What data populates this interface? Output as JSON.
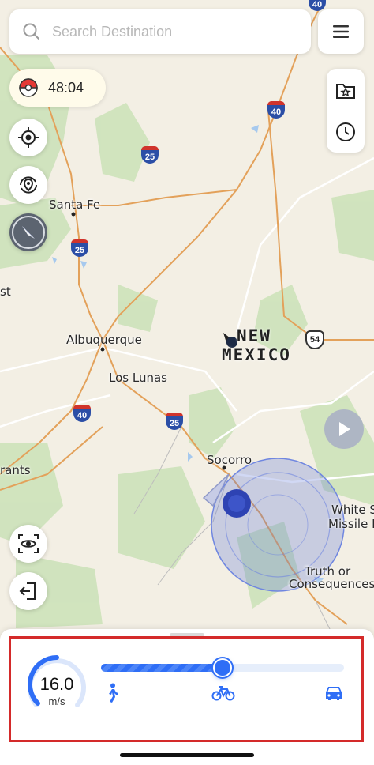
{
  "search": {
    "placeholder": "Search Destination"
  },
  "timer": {
    "value": "48:04"
  },
  "map_labels": {
    "santa_fe": "Santa Fe",
    "albuquerque": "Albuquerque",
    "los_lunas": "Los Lunas",
    "socorro": "Socorro",
    "state_line1": "NEW",
    "state_line2": "MEXICO",
    "white_sands_line1": "White Sa",
    "white_sands_line2": "Missile Ra",
    "truth_line1": "Truth or",
    "truth_line2": "Consequences",
    "edge_st": "st",
    "edge_rants": "rants"
  },
  "highways": {
    "i25_a": "25",
    "i25_b": "25",
    "i25_c": "25",
    "i40_a": "40",
    "i40_b": "40",
    "us54": "54",
    "top_partial": "40"
  },
  "speed": {
    "value": "16.0",
    "unit": "m/s",
    "level": 0.5
  },
  "colors": {
    "accent": "#2f6ef6",
    "highlight": "#d42a2a",
    "water": "#a6c9ee",
    "forest": "#c9e0b5",
    "road": "#e8a356"
  }
}
